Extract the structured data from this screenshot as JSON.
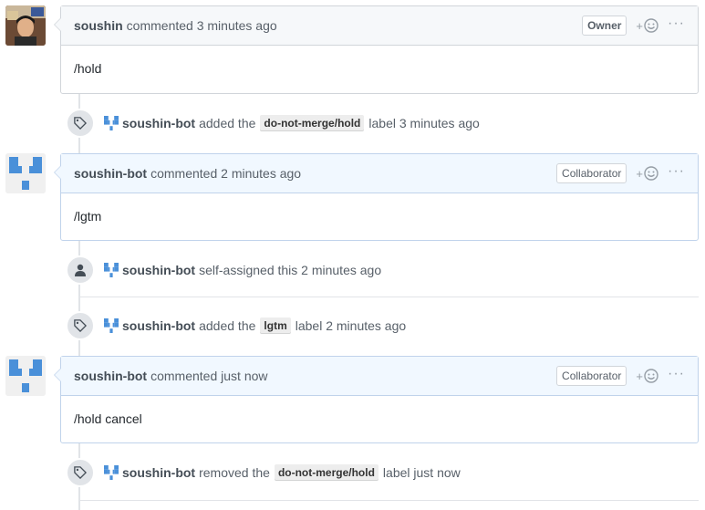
{
  "comments": [
    {
      "author": "soushin",
      "meta": "commented 3 minutes ago",
      "role": "Owner",
      "body": "/hold"
    },
    {
      "author": "soushin-bot",
      "meta": "commented 2 minutes ago",
      "role": "Collaborator",
      "body": "/lgtm"
    },
    {
      "author": "soushin-bot",
      "meta": "commented just now",
      "role": "Collaborator",
      "body": "/hold cancel"
    }
  ],
  "events": [
    {
      "actor": "soushin-bot",
      "pre": "added the",
      "label": "do-not-merge/hold",
      "post": "label 3 minutes ago"
    },
    {
      "actor": "soushin-bot",
      "text": "self-assigned this 2 minutes ago"
    },
    {
      "actor": "soushin-bot",
      "pre": "added the",
      "label": "lgtm",
      "post": "label 2 minutes ago"
    },
    {
      "actor": "soushin-bot",
      "pre": "removed the",
      "label": "do-not-merge/hold",
      "post": "label just now"
    }
  ],
  "ui": {
    "react_plus": "+",
    "more_dots": "···"
  },
  "colors": {
    "bot_identicon": "#4a90d9",
    "label_bg": "#ededed",
    "bot_header_bg": "#f1f8ff"
  }
}
